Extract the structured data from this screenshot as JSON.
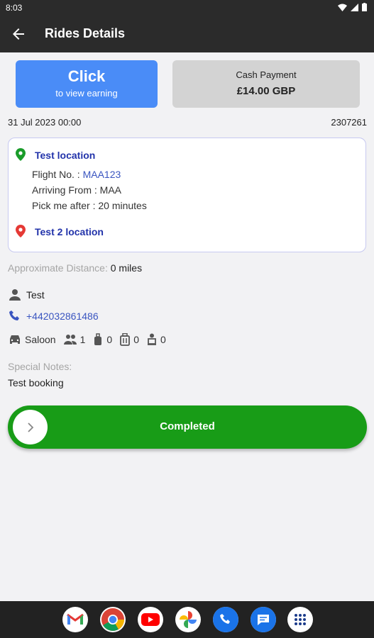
{
  "status_bar": {
    "time": "8:03"
  },
  "app_bar": {
    "title": "Rides Details"
  },
  "earning_button": {
    "title": "Click",
    "subtitle": "to view earning"
  },
  "payment": {
    "label": "Cash Payment",
    "amount": "£14.00 GBP"
  },
  "ride": {
    "date": "31 Jul 2023 00:00",
    "reference": "2307261",
    "pickup": "Test location",
    "flight_label": "Flight No. : ",
    "flight_no": "MAA123",
    "arriving_from": "Arriving From : MAA",
    "pick_me_after": "Pick me after : 20 minutes",
    "dropoff": "Test 2 location",
    "distance_label": "Approximate Distance:",
    "distance_value": " 0 miles"
  },
  "passenger": {
    "name": "Test",
    "phone": "+442032861486"
  },
  "vehicle": {
    "type": "Saloon",
    "passengers": "1",
    "bags": "0",
    "luggage": "0",
    "child_seats": "0"
  },
  "notes": {
    "label": "Special Notes:",
    "text": "Test booking"
  },
  "slider": {
    "label": "Completed"
  },
  "colors": {
    "accent_blue": "#4a8cf7",
    "complete_green": "#189c17",
    "pickup_pin": "#1a9c2a",
    "dropoff_pin": "#e53935"
  },
  "dock_apps": [
    "gmail-icon",
    "chrome-icon",
    "youtube-icon",
    "photos-icon",
    "phone-icon",
    "messages-icon",
    "app-drawer-icon"
  ]
}
